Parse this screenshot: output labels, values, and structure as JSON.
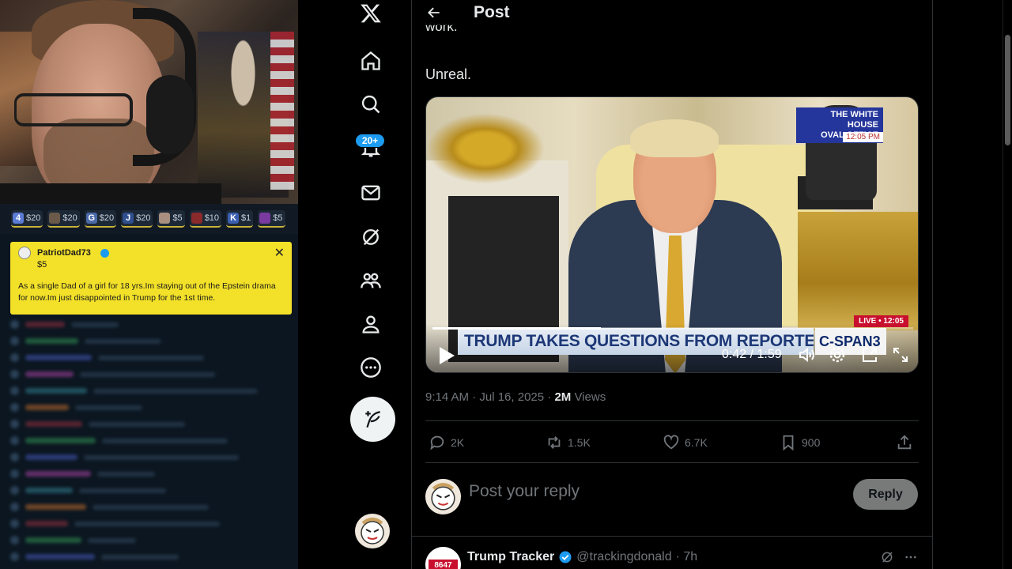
{
  "stream": {
    "tips": [
      {
        "letter": "4",
        "amount": "$20",
        "color": "#5b7bd5"
      },
      {
        "letter": "",
        "amount": "$20",
        "color": "#6b5a4a"
      },
      {
        "letter": "G",
        "amount": "$20",
        "color": "#4a6aa8"
      },
      {
        "letter": "J",
        "amount": "$20",
        "color": "#2f4f8f"
      },
      {
        "letter": "",
        "amount": "$5",
        "color": "#a88f80"
      },
      {
        "letter": "",
        "amount": "$10",
        "color": "#8a2a2a"
      },
      {
        "letter": "K",
        "amount": "$1",
        "color": "#3b5fb0"
      },
      {
        "letter": "",
        "amount": "$5",
        "color": "#7a3aa0"
      }
    ],
    "donation": {
      "username": "PatriotDad73",
      "amount": "$5",
      "message": "As a single Dad of a girl for 18 yrs.Im staying out of the Epstein drama for now.Im just disappointed in Trump for the 1st time."
    }
  },
  "nav": {
    "notifications_badge": "20+",
    "items": [
      "x-logo",
      "home-icon",
      "search-icon",
      "notifications-icon",
      "messages-icon",
      "grok-icon",
      "communities-icon",
      "profile-icon",
      "more-icon"
    ]
  },
  "header": {
    "title": "Post"
  },
  "tweet": {
    "cut_text": "work.",
    "text": "Unreal.",
    "video": {
      "wh_badge_line1": "THE WHITE HOUSE",
      "wh_badge_line2": "OVAL OFFICE",
      "wh_time": "12:05 PM",
      "live": "LIVE • 12:05",
      "lower_third": "TRUMP TAKES QUESTIONS FROM REPORTERS",
      "network": "C-SPAN3",
      "time": "0:42 / 1:59",
      "progress": 0.35
    },
    "timestamp": "9:14 AM · Jul 16, 2025 · ",
    "views_count": "2M",
    "views_label": " Views",
    "replies": "2K",
    "reposts": "1.5K",
    "likes": "6.7K",
    "bookmarks": "900"
  },
  "reply": {
    "placeholder": "Post your reply",
    "button": "Reply"
  },
  "reply_tweet": {
    "name": "Trump Tracker",
    "handle": "@trackingdonald",
    "age": "· 7h",
    "avatar_text": "8647"
  },
  "colors": {
    "accent": "#1d9bf0",
    "donation_bg": "#f3e129",
    "live_red": "#c8102e"
  }
}
